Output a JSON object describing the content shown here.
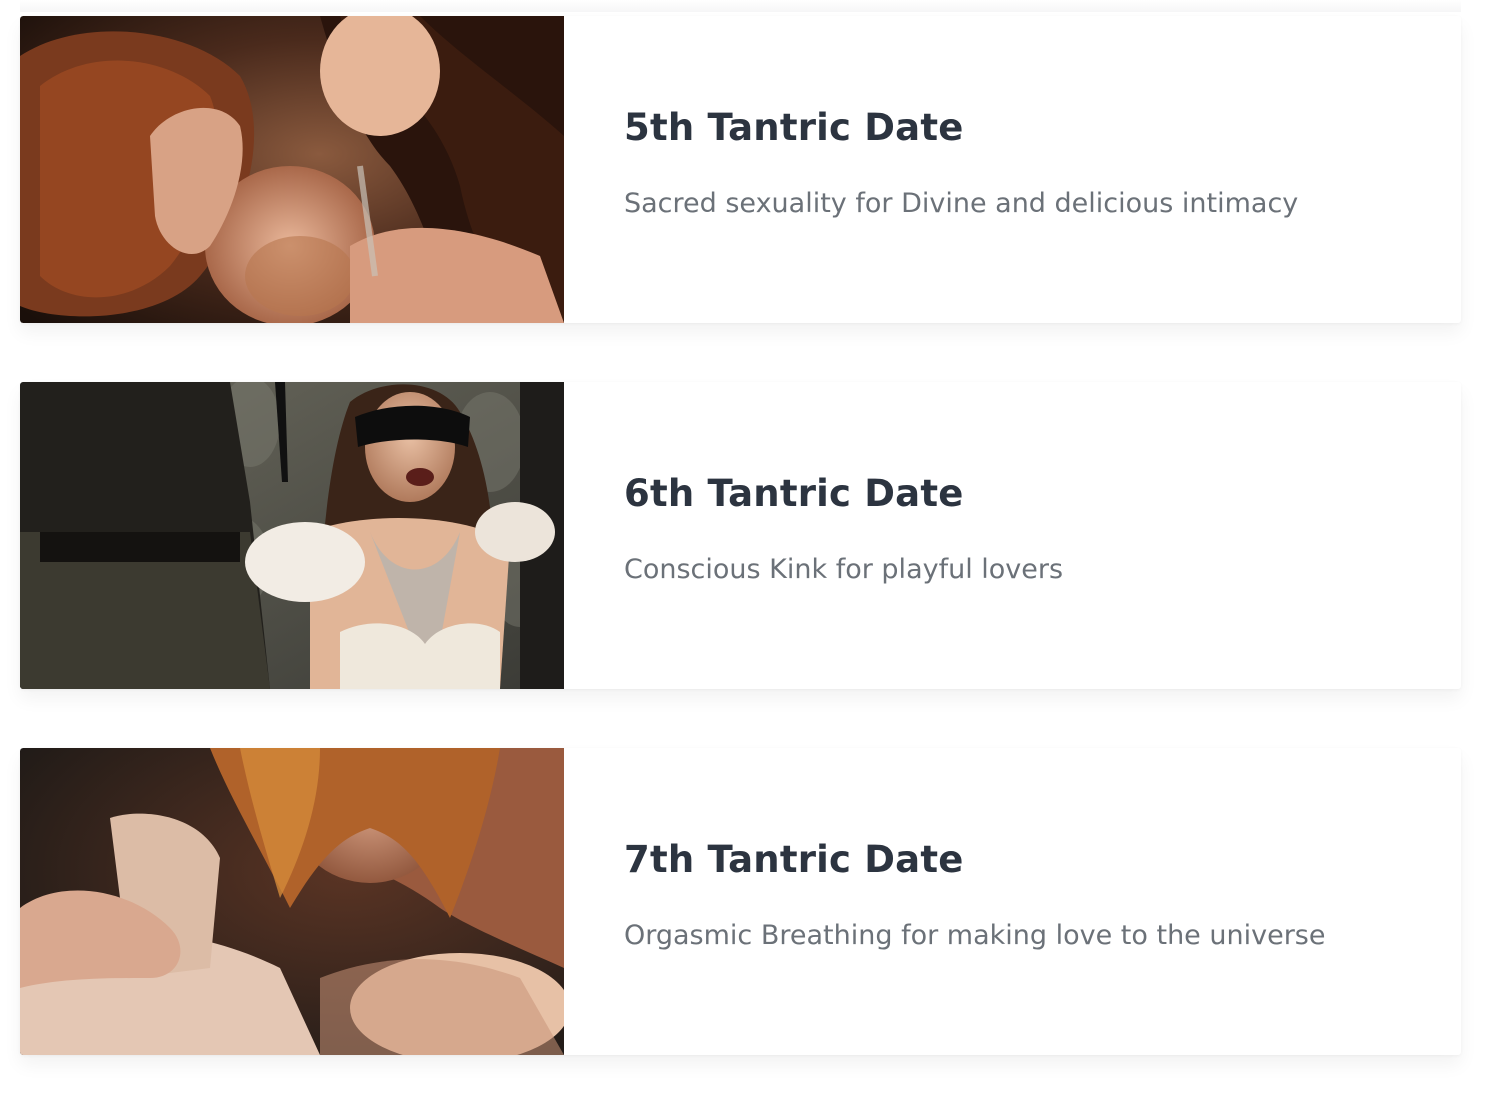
{
  "cards": [
    {
      "title": "5th Tantric Date",
      "subtitle": "Sacred sexuality for Divine and delicious intimacy",
      "image_icon": "couple-embrace-photo"
    },
    {
      "title": "6th Tantric Date",
      "subtitle": "Conscious Kink for playful lovers",
      "image_icon": "blindfolded-woman-photo"
    },
    {
      "title": "7th Tantric Date",
      "subtitle": "Orgasmic Breathing for making love to the universe",
      "image_icon": "couple-breathing-photo"
    }
  ]
}
